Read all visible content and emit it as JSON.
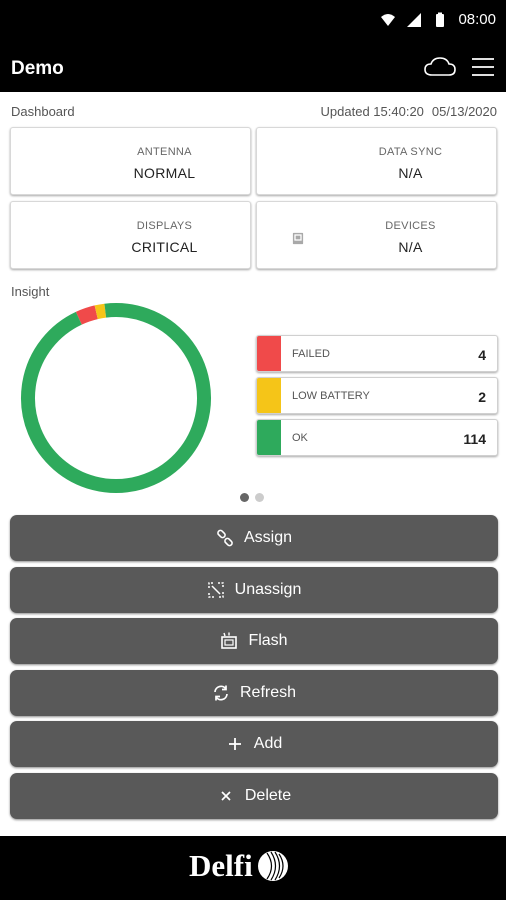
{
  "status_bar": {
    "time": "08:00",
    "icons": [
      "wifi-icon",
      "signal-icon",
      "battery-icon"
    ]
  },
  "app_bar": {
    "title": "Demo",
    "icons": [
      "cloud-icon",
      "hamburger-menu-icon"
    ]
  },
  "dashboard": {
    "label": "Dashboard",
    "updated_prefix": "Updated 15:40:20",
    "updated_date": "05/13/2020",
    "tiles": [
      {
        "label": "ANTENNA",
        "value": "NORMAL",
        "color": "#2eaa5c",
        "icon": "wifi-icon"
      },
      {
        "label": "DATA SYNC",
        "value": "N/A",
        "color": "#a9a9a9",
        "icon": "sync-icon"
      },
      {
        "label": "DISPLAYS",
        "value": "CRITICAL",
        "color": "#f04a4a",
        "icon": "display-icon"
      },
      {
        "label": "DEVICES",
        "value": "N/A",
        "color": "#a9a9a9",
        "icon": "devices-icon"
      }
    ]
  },
  "insight": {
    "label": "Insight",
    "legend": [
      {
        "label": "FAILED",
        "count": "4",
        "color": "#f04a4a"
      },
      {
        "label": "LOW BATTERY",
        "count": "2",
        "color": "#f5c518"
      },
      {
        "label": "OK",
        "count": "114",
        "color": "#2eaa5c"
      }
    ],
    "pager": {
      "pages": 2,
      "active": 0
    }
  },
  "chart_data": {
    "type": "pie",
    "categories": [
      "FAILED",
      "LOW BATTERY",
      "OK"
    ],
    "values": [
      4,
      2,
      114
    ],
    "colors": [
      "#f04a4a",
      "#f5c518",
      "#2eaa5c"
    ],
    "title": ""
  },
  "actions": [
    {
      "label": "Assign",
      "icon": "link-icon"
    },
    {
      "label": "Unassign",
      "icon": "unlink-icon"
    },
    {
      "label": "Flash",
      "icon": "flash-icon"
    },
    {
      "label": "Refresh",
      "icon": "refresh-icon"
    },
    {
      "label": "Add",
      "icon": "plus-icon"
    },
    {
      "label": "Delete",
      "icon": "close-icon"
    }
  ],
  "footer": {
    "brand": "Delfi"
  }
}
